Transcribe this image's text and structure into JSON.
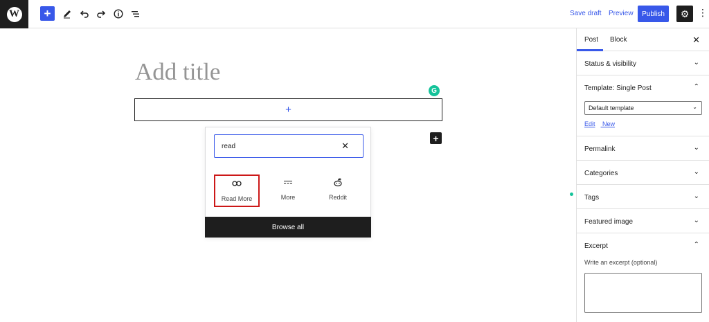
{
  "toolbar": {
    "add_label": "+",
    "save_draft": "Save draft",
    "preview": "Preview",
    "publish": "Publish",
    "icons": [
      "wordpress-logo",
      "add-block-icon",
      "pen-icon",
      "undo-icon",
      "redo-icon",
      "info-icon",
      "list-view-icon",
      "settings-gear-icon",
      "more-options-icon"
    ]
  },
  "editor": {
    "title_placeholder": "Add title",
    "appender_label": "+",
    "side_plus": "+"
  },
  "inserter": {
    "search_value": "read",
    "blocks": [
      {
        "label": "Read More",
        "icon": "link-icon"
      },
      {
        "label": "More",
        "icon": "more-divider-icon"
      },
      {
        "label": "Reddit",
        "icon": "reddit-icon"
      }
    ],
    "browse_all": "Browse all"
  },
  "sidebar": {
    "tabs": [
      "Post",
      "Block"
    ],
    "active_tab": "Post",
    "panels": {
      "status": "Status & visibility",
      "template": "Template: Single Post",
      "template_select": "Default template",
      "template_edit": "Edit",
      "template_new": "New",
      "permalink": "Permalink",
      "categories": "Categories",
      "tags": "Tags",
      "featured": "Featured image",
      "excerpt": "Excerpt",
      "excerpt_help": "Write an excerpt (optional)"
    }
  },
  "colors": {
    "accent": "#3858e9",
    "dark": "#1e1e1e",
    "selection_border": "#cc1818",
    "grammarly": "#15c39a"
  }
}
